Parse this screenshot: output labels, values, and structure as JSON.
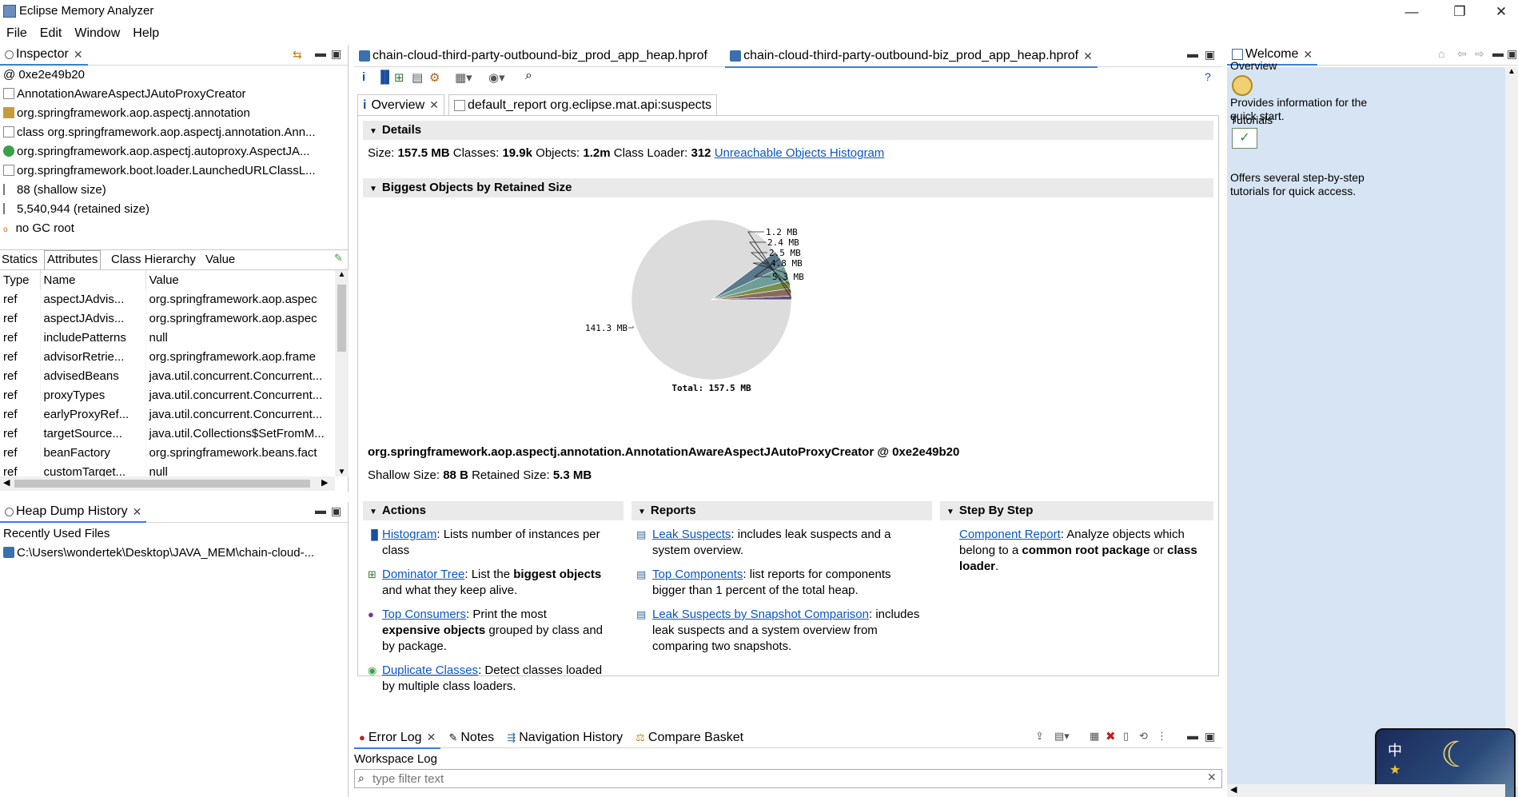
{
  "window": {
    "title": "Eclipse Memory Analyzer",
    "min": "—",
    "max": "❐",
    "close": "✕"
  },
  "menu": [
    "File",
    "Edit",
    "Window",
    "Help"
  ],
  "inspector": {
    "tab": "Inspector",
    "lines": [
      "0xe2e49b20",
      "AnnotationAwareAspectJAutoProxyCreator",
      "org.springframework.aop.aspectj.annotation",
      "class org.springframework.aop.aspectj.annotation.Ann...",
      "org.springframework.aop.aspectj.autoproxy.AspectJA...",
      "org.springframework.boot.loader.LaunchedURLClassL...",
      "88 (shallow size)",
      "5,540,944 (retained size)",
      "no GC root"
    ],
    "subtabs": [
      "Statics",
      "Attributes",
      "Class Hierarchy",
      "Value"
    ],
    "columns": [
      "Type",
      "Name",
      "Value"
    ],
    "rows": [
      [
        "ref",
        "aspectJAdvis...",
        "org.springframework.aop.aspec"
      ],
      [
        "ref",
        "aspectJAdvis...",
        "org.springframework.aop.aspec"
      ],
      [
        "ref",
        "includePatterns",
        "null"
      ],
      [
        "ref",
        "advisorRetrie...",
        "org.springframework.aop.frame"
      ],
      [
        "ref",
        "advisedBeans",
        "java.util.concurrent.Concurrent..."
      ],
      [
        "ref",
        "proxyTypes",
        "java.util.concurrent.Concurrent..."
      ],
      [
        "ref",
        "earlyProxyRef...",
        "java.util.concurrent.Concurrent..."
      ],
      [
        "ref",
        "targetSource...",
        "java.util.Collections$SetFromM..."
      ],
      [
        "ref",
        "beanFactory",
        "org.springframework.beans.fact"
      ],
      [
        "ref",
        "customTarget...",
        "null"
      ]
    ]
  },
  "heapHistory": {
    "tab": "Heap Dump History",
    "heading": "Recently Used Files",
    "file": "C:\\Users\\wondertek\\Desktop\\JAVA_MEM\\chain-cloud-..."
  },
  "editor": {
    "tabs": [
      "chain-cloud-third-party-outbound-biz_prod_app_heap.hprof",
      "chain-cloud-third-party-outbound-biz_prod_app_heap.hprof"
    ],
    "subtabs": [
      "Overview",
      "default_report org.eclipse.mat.api:suspects"
    ],
    "details": {
      "header": "Details",
      "size_label": "Size:",
      "size": "157.5 MB",
      "classes_label": "Classes:",
      "classes": "19.9k",
      "objects_label": "Objects:",
      "objects": "1.2m",
      "loader_label": "Class Loader:",
      "loader": "312",
      "link": "Unreachable Objects Histogram"
    },
    "biggest": {
      "header": "Biggest Objects by Retained Size",
      "object": "org.springframework.aop.aspectj.annotation.AnnotationAwareAspectJAutoProxyCreator @ 0xe2e49b20",
      "shallow_label": "Shallow Size:",
      "shallow": "88 B",
      "retained_label": "Retained Size:",
      "retained": "5.3 MB"
    },
    "actions": {
      "header": "Actions",
      "items": [
        {
          "link": "Histogram",
          "pre": ": Lists number of instances per class",
          "b1": "",
          "mid": "",
          "b2": "",
          "post": ""
        },
        {
          "link": "Dominator Tree",
          "pre": ": List the ",
          "b1": "biggest objects",
          "mid": " and what they keep alive.",
          "b2": "",
          "post": ""
        },
        {
          "link": "Top Consumers",
          "pre": ": Print the most ",
          "b1": "expensive objects",
          "mid": " grouped by class and by package.",
          "b2": "",
          "post": ""
        },
        {
          "link": "Duplicate Classes",
          "pre": ": Detect classes loaded by multiple class loaders.",
          "b1": "",
          "mid": "",
          "b2": "",
          "post": ""
        }
      ]
    },
    "reports": {
      "header": "Reports",
      "items": [
        {
          "link": "Leak Suspects",
          "text": ": includes leak suspects and a system overview."
        },
        {
          "link": "Top Components",
          "text": ": list reports for components bigger than 1 percent of the total heap."
        },
        {
          "link": "Leak Suspects by Snapshot Comparison",
          "text": ": includes leak suspects and a system overview from comparing two snapshots."
        }
      ]
    },
    "step": {
      "header": "Step By Step",
      "link": "Component Report",
      "pre": ": Analyze objects which belong to a ",
      "b1": "common root package",
      "mid": " or ",
      "b2": "class loader",
      "post": "."
    }
  },
  "chart_data": {
    "type": "pie",
    "title": "",
    "unit": "MB",
    "slices": [
      {
        "label": "1.2 MB",
        "value": 1.2,
        "color": "#5c4d7d"
      },
      {
        "label": "2.4 MB",
        "value": 2.4,
        "color": "#8b6a5e"
      },
      {
        "label": "2.5 MB",
        "value": 2.5,
        "color": "#7a8f4a"
      },
      {
        "label": "4.8 MB",
        "value": 4.8,
        "color": "#6e9e9a"
      },
      {
        "label": "5.3 MB",
        "value": 5.3,
        "color": "#5a7a8c"
      },
      {
        "label": "141.3 MB",
        "value": 141.3,
        "color": "#dcdcdc"
      }
    ],
    "total_label": "Total:  157.5 MB"
  },
  "bottom": {
    "tabs": [
      "Error Log",
      "Notes",
      "Navigation History",
      "Compare Basket"
    ],
    "heading": "Workspace Log",
    "filter_placeholder": "type filter text"
  },
  "welcome": {
    "tab": "Welcome",
    "overview_title": "Overview",
    "overview_text": "Provides information for the quick start.",
    "tutorials_title": "Tutorials",
    "tutorials_text": "Offers several step-by-step tutorials for quick access."
  },
  "colors": {
    "link": "#0b55c4",
    "section": "#eaeaea",
    "welcome_bg": "#d6e4f3",
    "active_tab": "#3a7dd8"
  }
}
